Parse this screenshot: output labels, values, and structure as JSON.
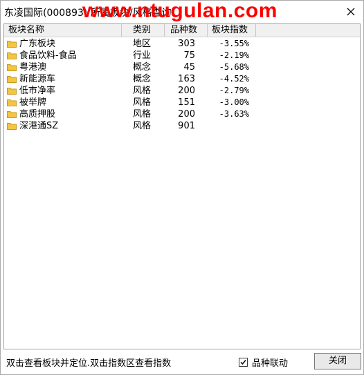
{
  "window": {
    "title": "东凌国际(000893) 所属板块/风格查询",
    "watermark": "www.ntugulan.com"
  },
  "table": {
    "headers": {
      "name": "板块名称",
      "category": "类别",
      "count": "品种数",
      "index": "板块指数"
    },
    "rows": [
      {
        "name": "广东板块",
        "category": "地区",
        "count": "303",
        "index": "-3.55%"
      },
      {
        "name": "食品饮料-食品",
        "category": "行业",
        "count": "75",
        "index": "-2.19%"
      },
      {
        "name": "粤港澳",
        "category": "概念",
        "count": "45",
        "index": "-5.68%"
      },
      {
        "name": "新能源车",
        "category": "概念",
        "count": "163",
        "index": "-4.52%"
      },
      {
        "name": "低市净率",
        "category": "风格",
        "count": "200",
        "index": "-2.79%"
      },
      {
        "name": "被举牌",
        "category": "风格",
        "count": "151",
        "index": "-3.00%"
      },
      {
        "name": "高质押股",
        "category": "风格",
        "count": "200",
        "index": "-3.63%"
      },
      {
        "name": "深港通SZ",
        "category": "风格",
        "count": "901",
        "index": ""
      }
    ]
  },
  "footer": {
    "hint": "双击查看板块并定位.双击指数区查看指数",
    "checkbox_label": "品种联动",
    "checkbox_checked": true,
    "close_label": "关闭"
  },
  "colors": {
    "folder": "#f5c542",
    "watermark": "#ff0000"
  },
  "icons": {
    "folder": "folder-icon",
    "close": "close-icon",
    "check": "check-icon"
  }
}
